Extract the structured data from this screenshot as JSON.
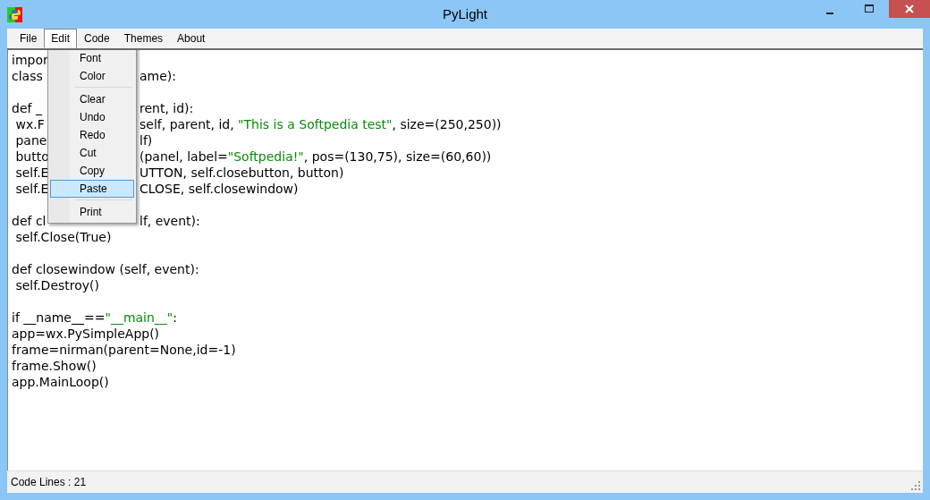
{
  "window": {
    "title": "PyLight"
  },
  "menu_bar": [
    {
      "label": "File",
      "selected": false
    },
    {
      "label": "Edit",
      "selected": true
    },
    {
      "label": "Code",
      "selected": false
    },
    {
      "label": "Themes",
      "selected": false
    },
    {
      "label": "About",
      "selected": false
    }
  ],
  "edit_menu": [
    {
      "kind": "item",
      "label": "Font",
      "selected": false
    },
    {
      "kind": "item",
      "label": "Color",
      "selected": false
    },
    {
      "kind": "separator"
    },
    {
      "kind": "item",
      "label": "Clear",
      "selected": false
    },
    {
      "kind": "item",
      "label": "Undo",
      "selected": false
    },
    {
      "kind": "item",
      "label": "Redo",
      "selected": false
    },
    {
      "kind": "item",
      "label": "Cut",
      "selected": false
    },
    {
      "kind": "item",
      "label": "Copy",
      "selected": false
    },
    {
      "kind": "item",
      "label": "Paste",
      "selected": true
    },
    {
      "kind": "separator"
    },
    {
      "kind": "item",
      "label": "Print",
      "selected": false
    }
  ],
  "editor": {
    "lines": [
      {
        "segments": [
          {
            "kind": "code",
            "text": "impor"
          }
        ]
      },
      {
        "segments": [
          {
            "kind": "code",
            "text": "class"
          }
        ],
        "after_menu": [
          {
            "kind": "code",
            "text": "ame):"
          }
        ]
      },
      {
        "kind": "blank"
      },
      {
        "segments": [
          {
            "kind": "code",
            "text": "def _"
          }
        ],
        "after_menu": [
          {
            "kind": "code",
            "text": "rent, id):"
          }
        ]
      },
      {
        "segments": [
          {
            "kind": "code",
            "text": " wx.F"
          }
        ],
        "after_menu": [
          {
            "kind": "code",
            "text": "self, parent, id, "
          },
          {
            "kind": "string",
            "text": "\"This is a Softpedia test\""
          },
          {
            "kind": "code",
            "text": ", size=(250,250))"
          }
        ]
      },
      {
        "segments": [
          {
            "kind": "code",
            "text": " pane"
          }
        ],
        "after_menu": [
          {
            "kind": "code",
            "text": "lf)"
          }
        ]
      },
      {
        "segments": [
          {
            "kind": "code",
            "text": " butto"
          }
        ],
        "after_menu": [
          {
            "kind": "code",
            "text": "(panel, label="
          },
          {
            "kind": "string",
            "text": "\"Softpedia!\""
          },
          {
            "kind": "code",
            "text": ", pos=(130,75), size=(60,60))"
          }
        ]
      },
      {
        "segments": [
          {
            "kind": "code",
            "text": " self.E"
          }
        ],
        "after_menu": [
          {
            "kind": "code",
            "text": "UTTON, self.closebutton, button)"
          }
        ]
      },
      {
        "segments": [
          {
            "kind": "code",
            "text": " self.E"
          }
        ],
        "after_menu": [
          {
            "kind": "code",
            "text": "CLOSE, self.closewindow)"
          }
        ]
      },
      {
        "kind": "blank"
      },
      {
        "segments": [
          {
            "kind": "code",
            "text": "def cl"
          }
        ],
        "after_menu": [
          {
            "kind": "code",
            "text": "lf, event):"
          }
        ]
      },
      {
        "segments": [
          {
            "kind": "code",
            "text": " self.Close(True)"
          }
        ]
      },
      {
        "kind": "blank"
      },
      {
        "segments": [
          {
            "kind": "code",
            "text": "def closewindow (self, event):"
          }
        ]
      },
      {
        "segments": [
          {
            "kind": "code",
            "text": " self.Destroy()"
          }
        ]
      },
      {
        "kind": "blank"
      },
      {
        "segments": [
          {
            "kind": "code",
            "text": "if __name__=="
          },
          {
            "kind": "string",
            "text": "\"__main__\""
          },
          {
            "kind": "code",
            "text": ":"
          }
        ]
      },
      {
        "segments": [
          {
            "kind": "code",
            "text": "app=wx.PySimpleApp()"
          }
        ]
      },
      {
        "segments": [
          {
            "kind": "code",
            "text": "frame=nirman(parent=None,id=-1)"
          }
        ]
      },
      {
        "segments": [
          {
            "kind": "code",
            "text": "frame.Show()"
          }
        ]
      },
      {
        "segments": [
          {
            "kind": "code",
            "text": "app.MainLoop()"
          }
        ]
      }
    ]
  },
  "status_bar": {
    "text": "Code Lines : 21"
  }
}
